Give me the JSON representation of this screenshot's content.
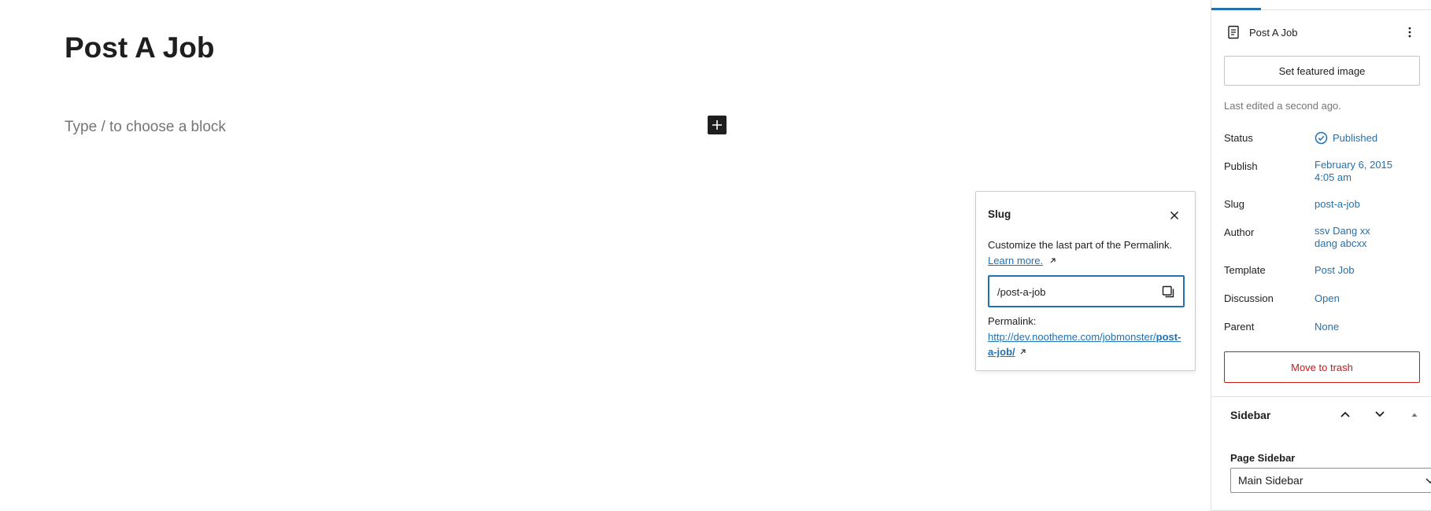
{
  "editor": {
    "title": "Post A Job",
    "block_placeholder": "Type / to choose a block"
  },
  "slug_popover": {
    "title": "Slug",
    "description": "Customize the last part of the Permalink.",
    "learn_more": "Learn more.",
    "slug_value": "/post-a-job",
    "permalink_label": "Permalink:",
    "permalink_base": "http://dev.nootheme.com/jobmonster/",
    "permalink_slug": "post-a-job/"
  },
  "sidebar": {
    "doc_title": "Post A Job",
    "featured_image_button": "Set featured image",
    "last_edited": "Last edited a second ago.",
    "rows": [
      {
        "label": "Status",
        "value": "Published"
      },
      {
        "label": "Publish",
        "value_line1": "February 6, 2015",
        "value_line2": "4:05 am"
      },
      {
        "label": "Slug",
        "value": "post-a-job"
      },
      {
        "label": "Author",
        "value_line1": "ssv Dang xx",
        "value_line2": "dang abcxx"
      },
      {
        "label": "Template",
        "value": "Post Job"
      },
      {
        "label": "Discussion",
        "value": "Open"
      },
      {
        "label": "Parent",
        "value": "None"
      }
    ],
    "trash_button": "Move to trash",
    "panel": {
      "title": "Sidebar",
      "field_label": "Page Sidebar",
      "selected": "Main Sidebar"
    }
  },
  "colors": {
    "accent": "#2271b1",
    "danger": "#cc1818",
    "muted": "#757575"
  }
}
